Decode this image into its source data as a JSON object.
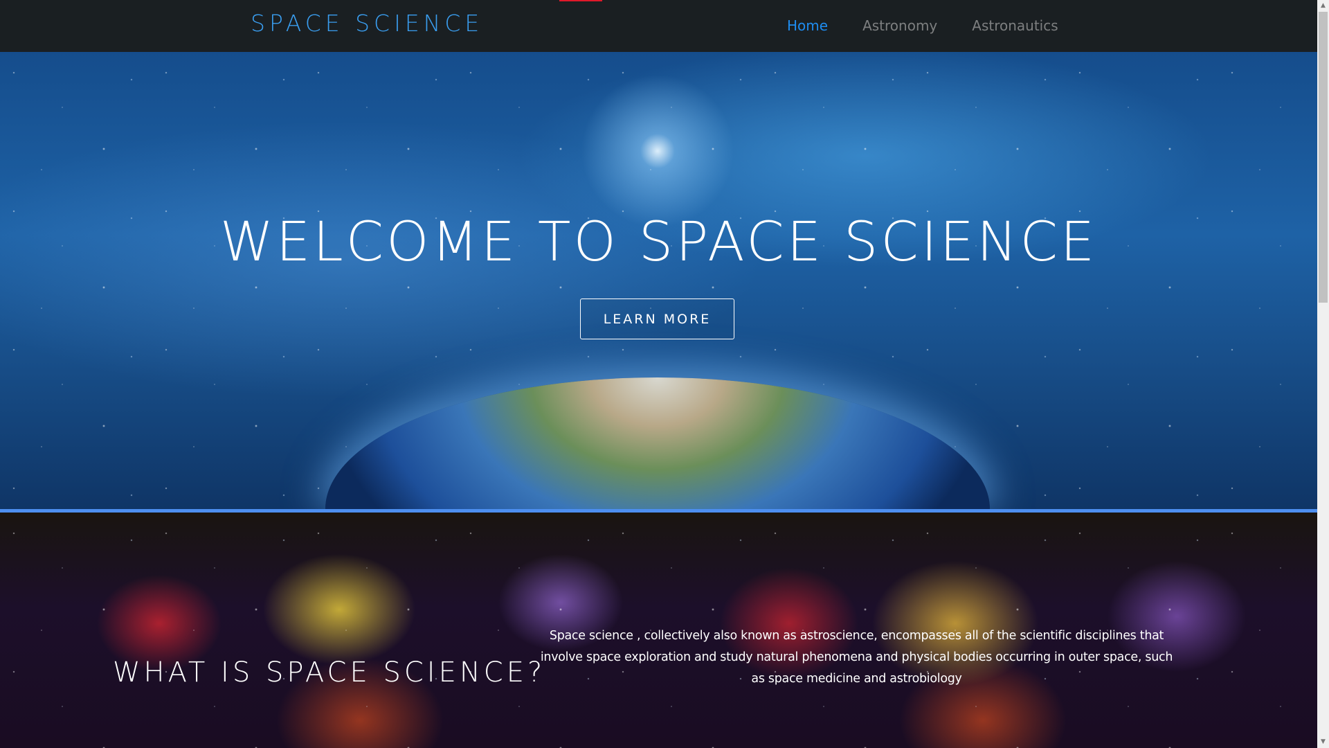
{
  "nav": {
    "logo": "SPACE SCIENCE",
    "links": [
      {
        "label": "Home",
        "active": true
      },
      {
        "label": "Astronomy"
      },
      {
        "label": "Astronautics"
      }
    ]
  },
  "hero": {
    "title": "WELCOME TO SPACE SCIENCE",
    "button": "LEARN MORE"
  },
  "about": {
    "heading": "WHAT IS SPACE SCIENCE?",
    "text": "Space science , collectively also known as astroscience, encompasses all of the scientific disciplines that involve space exploration and study natural phenomena and physical bodies occurring in outer space, such as space medicine and astrobiology"
  },
  "colors": {
    "accent": "#1e8cf0",
    "nav_bg": "#1a1f22",
    "divider": "#4d8ff0"
  }
}
